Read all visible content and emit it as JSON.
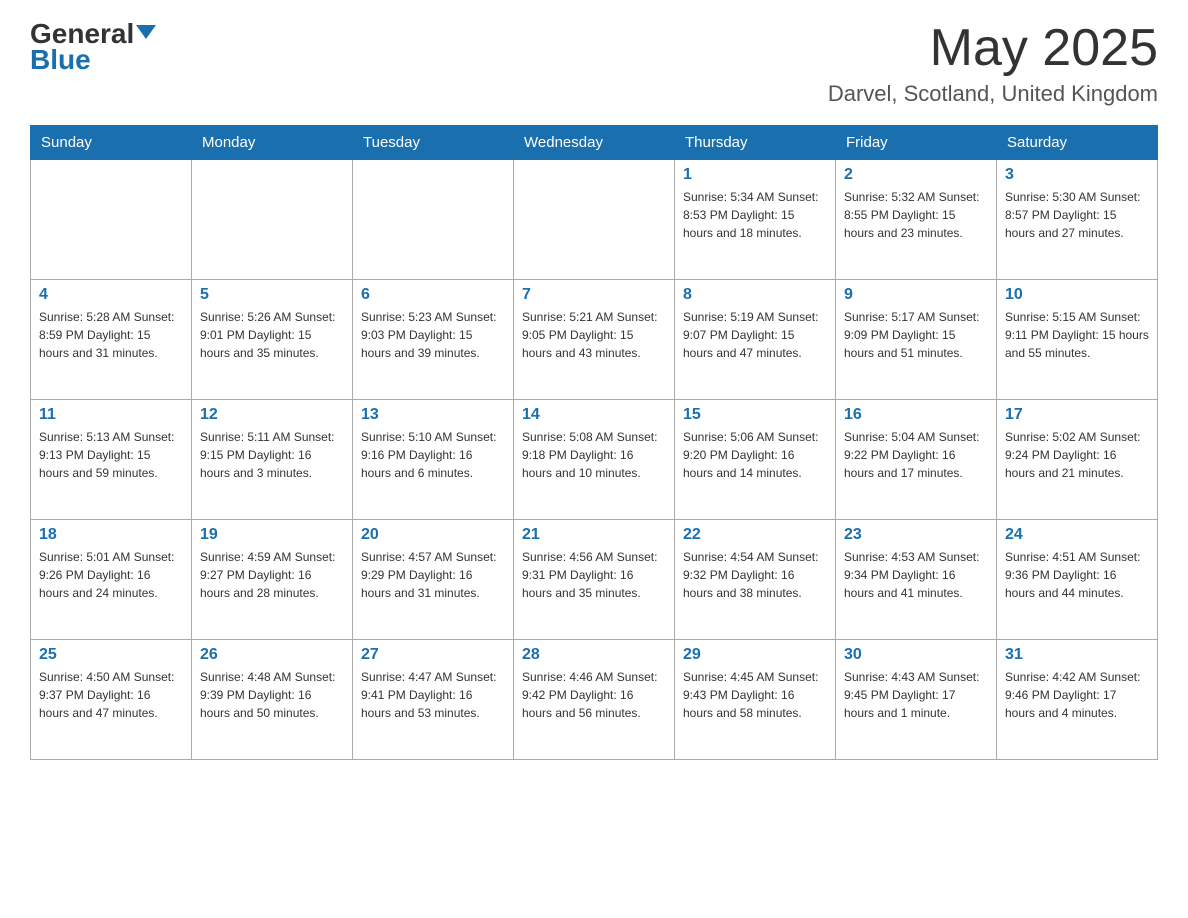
{
  "header": {
    "logo": {
      "general": "General",
      "blue": "Blue",
      "triangle": true
    },
    "month_title": "May 2025",
    "location": "Darvel, Scotland, United Kingdom"
  },
  "calendar": {
    "days_of_week": [
      "Sunday",
      "Monday",
      "Tuesday",
      "Wednesday",
      "Thursday",
      "Friday",
      "Saturday"
    ],
    "weeks": [
      [
        {
          "day": "",
          "info": ""
        },
        {
          "day": "",
          "info": ""
        },
        {
          "day": "",
          "info": ""
        },
        {
          "day": "",
          "info": ""
        },
        {
          "day": "1",
          "info": "Sunrise: 5:34 AM\nSunset: 8:53 PM\nDaylight: 15 hours\nand 18 minutes."
        },
        {
          "day": "2",
          "info": "Sunrise: 5:32 AM\nSunset: 8:55 PM\nDaylight: 15 hours\nand 23 minutes."
        },
        {
          "day": "3",
          "info": "Sunrise: 5:30 AM\nSunset: 8:57 PM\nDaylight: 15 hours\nand 27 minutes."
        }
      ],
      [
        {
          "day": "4",
          "info": "Sunrise: 5:28 AM\nSunset: 8:59 PM\nDaylight: 15 hours\nand 31 minutes."
        },
        {
          "day": "5",
          "info": "Sunrise: 5:26 AM\nSunset: 9:01 PM\nDaylight: 15 hours\nand 35 minutes."
        },
        {
          "day": "6",
          "info": "Sunrise: 5:23 AM\nSunset: 9:03 PM\nDaylight: 15 hours\nand 39 minutes."
        },
        {
          "day": "7",
          "info": "Sunrise: 5:21 AM\nSunset: 9:05 PM\nDaylight: 15 hours\nand 43 minutes."
        },
        {
          "day": "8",
          "info": "Sunrise: 5:19 AM\nSunset: 9:07 PM\nDaylight: 15 hours\nand 47 minutes."
        },
        {
          "day": "9",
          "info": "Sunrise: 5:17 AM\nSunset: 9:09 PM\nDaylight: 15 hours\nand 51 minutes."
        },
        {
          "day": "10",
          "info": "Sunrise: 5:15 AM\nSunset: 9:11 PM\nDaylight: 15 hours\nand 55 minutes."
        }
      ],
      [
        {
          "day": "11",
          "info": "Sunrise: 5:13 AM\nSunset: 9:13 PM\nDaylight: 15 hours\nand 59 minutes."
        },
        {
          "day": "12",
          "info": "Sunrise: 5:11 AM\nSunset: 9:15 PM\nDaylight: 16 hours\nand 3 minutes."
        },
        {
          "day": "13",
          "info": "Sunrise: 5:10 AM\nSunset: 9:16 PM\nDaylight: 16 hours\nand 6 minutes."
        },
        {
          "day": "14",
          "info": "Sunrise: 5:08 AM\nSunset: 9:18 PM\nDaylight: 16 hours\nand 10 minutes."
        },
        {
          "day": "15",
          "info": "Sunrise: 5:06 AM\nSunset: 9:20 PM\nDaylight: 16 hours\nand 14 minutes."
        },
        {
          "day": "16",
          "info": "Sunrise: 5:04 AM\nSunset: 9:22 PM\nDaylight: 16 hours\nand 17 minutes."
        },
        {
          "day": "17",
          "info": "Sunrise: 5:02 AM\nSunset: 9:24 PM\nDaylight: 16 hours\nand 21 minutes."
        }
      ],
      [
        {
          "day": "18",
          "info": "Sunrise: 5:01 AM\nSunset: 9:26 PM\nDaylight: 16 hours\nand 24 minutes."
        },
        {
          "day": "19",
          "info": "Sunrise: 4:59 AM\nSunset: 9:27 PM\nDaylight: 16 hours\nand 28 minutes."
        },
        {
          "day": "20",
          "info": "Sunrise: 4:57 AM\nSunset: 9:29 PM\nDaylight: 16 hours\nand 31 minutes."
        },
        {
          "day": "21",
          "info": "Sunrise: 4:56 AM\nSunset: 9:31 PM\nDaylight: 16 hours\nand 35 minutes."
        },
        {
          "day": "22",
          "info": "Sunrise: 4:54 AM\nSunset: 9:32 PM\nDaylight: 16 hours\nand 38 minutes."
        },
        {
          "day": "23",
          "info": "Sunrise: 4:53 AM\nSunset: 9:34 PM\nDaylight: 16 hours\nand 41 minutes."
        },
        {
          "day": "24",
          "info": "Sunrise: 4:51 AM\nSunset: 9:36 PM\nDaylight: 16 hours\nand 44 minutes."
        }
      ],
      [
        {
          "day": "25",
          "info": "Sunrise: 4:50 AM\nSunset: 9:37 PM\nDaylight: 16 hours\nand 47 minutes."
        },
        {
          "day": "26",
          "info": "Sunrise: 4:48 AM\nSunset: 9:39 PM\nDaylight: 16 hours\nand 50 minutes."
        },
        {
          "day": "27",
          "info": "Sunrise: 4:47 AM\nSunset: 9:41 PM\nDaylight: 16 hours\nand 53 minutes."
        },
        {
          "day": "28",
          "info": "Sunrise: 4:46 AM\nSunset: 9:42 PM\nDaylight: 16 hours\nand 56 minutes."
        },
        {
          "day": "29",
          "info": "Sunrise: 4:45 AM\nSunset: 9:43 PM\nDaylight: 16 hours\nand 58 minutes."
        },
        {
          "day": "30",
          "info": "Sunrise: 4:43 AM\nSunset: 9:45 PM\nDaylight: 17 hours\nand 1 minute."
        },
        {
          "day": "31",
          "info": "Sunrise: 4:42 AM\nSunset: 9:46 PM\nDaylight: 17 hours\nand 4 minutes."
        }
      ]
    ]
  }
}
